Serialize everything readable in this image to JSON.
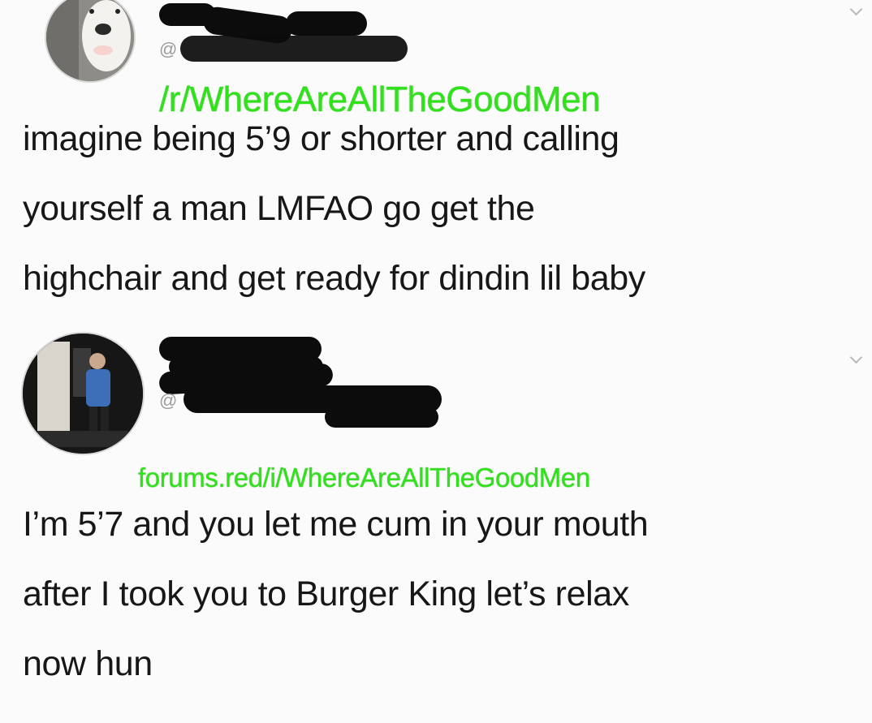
{
  "tweets": [
    {
      "handle": "@",
      "text": "imagine being 5’9 or shorter and calling\nyourself a man LMFAO go get the\nhighchair and get ready for dindin lil baby"
    },
    {
      "handle": "@",
      "text": "I’m 5’7 and you let me cum in your mouth\nafter I took you to Burger King let’s relax\nnow hun"
    }
  ],
  "watermarks": {
    "top": "/r/WhereAreAllTheGoodMen",
    "bottom": "forums.red/i/WhereAreAllTheGoodMen"
  },
  "colors": {
    "background": "#fbfbfb",
    "text": "#171717",
    "handle": "#9b9b9b",
    "watermark": "#2fe21a",
    "redaction": "#0c0c0c"
  },
  "icons": [
    "chevron-down-icon",
    "chevron-down-icon"
  ]
}
